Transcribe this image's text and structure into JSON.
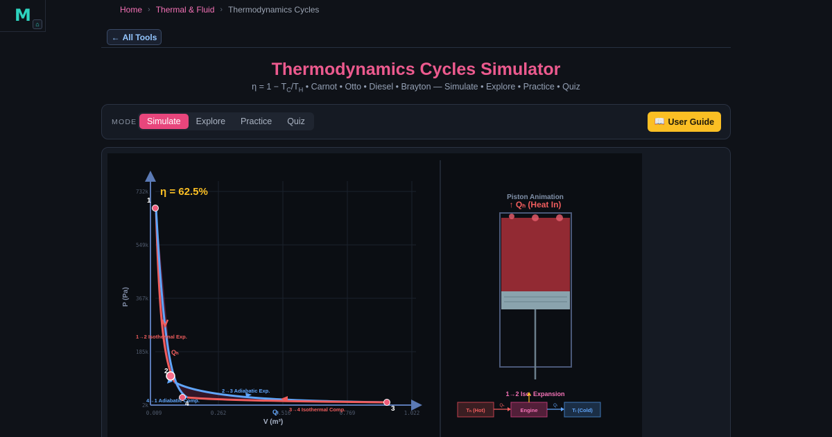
{
  "nav": {
    "breadcrumb": [
      {
        "label": "Home"
      },
      {
        "label": "Thermal & Fluid"
      },
      {
        "label": "Thermodynamics Cycles"
      }
    ],
    "back_label": "All Tools"
  },
  "header": {
    "title": "Thermodynamics Cycles Simulator",
    "subtitle_eta": "η = 1 − T",
    "subtitle_c": "C",
    "subtitle_slash": "/T",
    "subtitle_h": "H",
    "subtitle_rest": " • Carnot • Otto • Diesel • Brayton — Simulate • Explore • Practice • Quiz"
  },
  "mode": {
    "label": "MODE",
    "tabs": [
      {
        "label": "Simulate",
        "active": true
      },
      {
        "label": "Explore",
        "active": false
      },
      {
        "label": "Practice",
        "active": false
      },
      {
        "label": "Quiz",
        "active": false
      }
    ],
    "guide_label": "User Guide"
  },
  "pv": {
    "efficiency": "η = 62.5%",
    "ylabel": "P (Pa)",
    "xlabel": "V (m³)",
    "y_ticks": [
      "732k",
      "549k",
      "367k",
      "185k",
      "2k"
    ],
    "x_ticks": [
      "0.009",
      "0.262",
      "0.516",
      "0.769",
      "1.022"
    ],
    "points": [
      "1",
      "2",
      "3",
      "4"
    ],
    "labels": {
      "p12": "1→2 Isothermal Exp.",
      "p23": "2→3 Adiabatic Exp.",
      "p34": "3→4 Isothermal Comp.",
      "p41": "4→1 Adiabatic Comp.",
      "qh": "Qₕ",
      "qc": "Qₗ"
    }
  },
  "piston": {
    "title": "Piston Animation",
    "heat": "↑ Qₕ (Heat In)",
    "stage": "1→2 Iso. Expansion"
  },
  "engine": {
    "hot": "Tₕ (Hot)",
    "engine": "Engine",
    "cold": "Tₗ (Cold)",
    "qh": "Qₕ",
    "qc": "Qₗ"
  },
  "colors": {
    "accent": "#e8467c",
    "hot": "#f05d5d",
    "cold": "#60a5fa",
    "efficiency": "#fbbf24"
  }
}
